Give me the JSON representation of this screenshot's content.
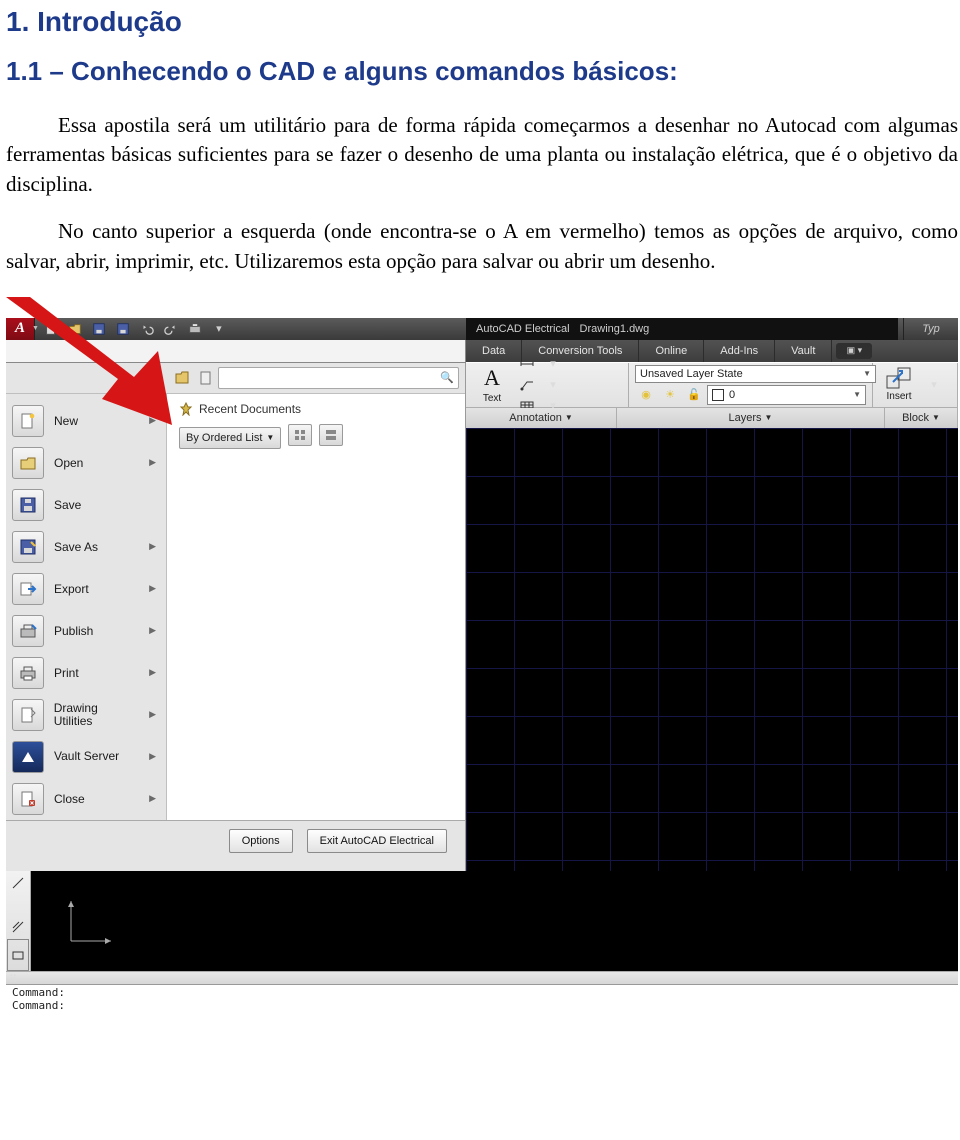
{
  "doc": {
    "h1": "1. Introdução",
    "h2": "1.1 – Conhecendo o CAD e alguns comandos básicos:",
    "p1": "Essa apostila será um utilitário para de forma rápida começarmos a desenhar no Autocad com algumas ferramentas básicas suficientes para se fazer o desenho de uma planta ou instalação elétrica, que é o objetivo da disciplina.",
    "p2": "No canto superior a esquerda (onde encontra-se o A em vermelho) temos as opções de arquivo, como salvar, abrir, imprimir, etc. Utilizaremos esta opção para salvar ou abrir um desenho."
  },
  "qat": {
    "app_letter": "A",
    "title_app": "AutoCAD Electrical",
    "title_doc": "Drawing1.dwg",
    "help_placeholder": "Typ"
  },
  "tabs": {
    "items": [
      "Data",
      "Conversion Tools",
      "Online",
      "Add-Ins",
      "Vault"
    ]
  },
  "search": {
    "icon": "🔍"
  },
  "recent": {
    "heading": "Recent Documents",
    "order_label": "By Ordered List"
  },
  "menu": {
    "items": [
      {
        "label": "New",
        "icon": "new"
      },
      {
        "label": "Open",
        "icon": "open"
      },
      {
        "label": "Save",
        "icon": "save"
      },
      {
        "label": "Save As",
        "icon": "saveas"
      },
      {
        "label": "Export",
        "icon": "export"
      },
      {
        "label": "Publish",
        "icon": "publish"
      },
      {
        "label": "Print",
        "icon": "print"
      },
      {
        "label": "Drawing Utilities",
        "icon": "util"
      },
      {
        "label": "Vault Server",
        "icon": "vault"
      },
      {
        "label": "Close",
        "icon": "close"
      }
    ]
  },
  "ribbon": {
    "text_label": "Text",
    "layer_state": "Unsaved Layer State",
    "layer_current": "0",
    "insert_label": "Insert",
    "panel_annotation": "Annotation",
    "panel_layers": "Layers",
    "panel_block": "Block"
  },
  "footer": {
    "options": "Options",
    "exit": "Exit AutoCAD Electrical"
  },
  "cmd": {
    "l1": "Command:",
    "l2": "Command:"
  }
}
